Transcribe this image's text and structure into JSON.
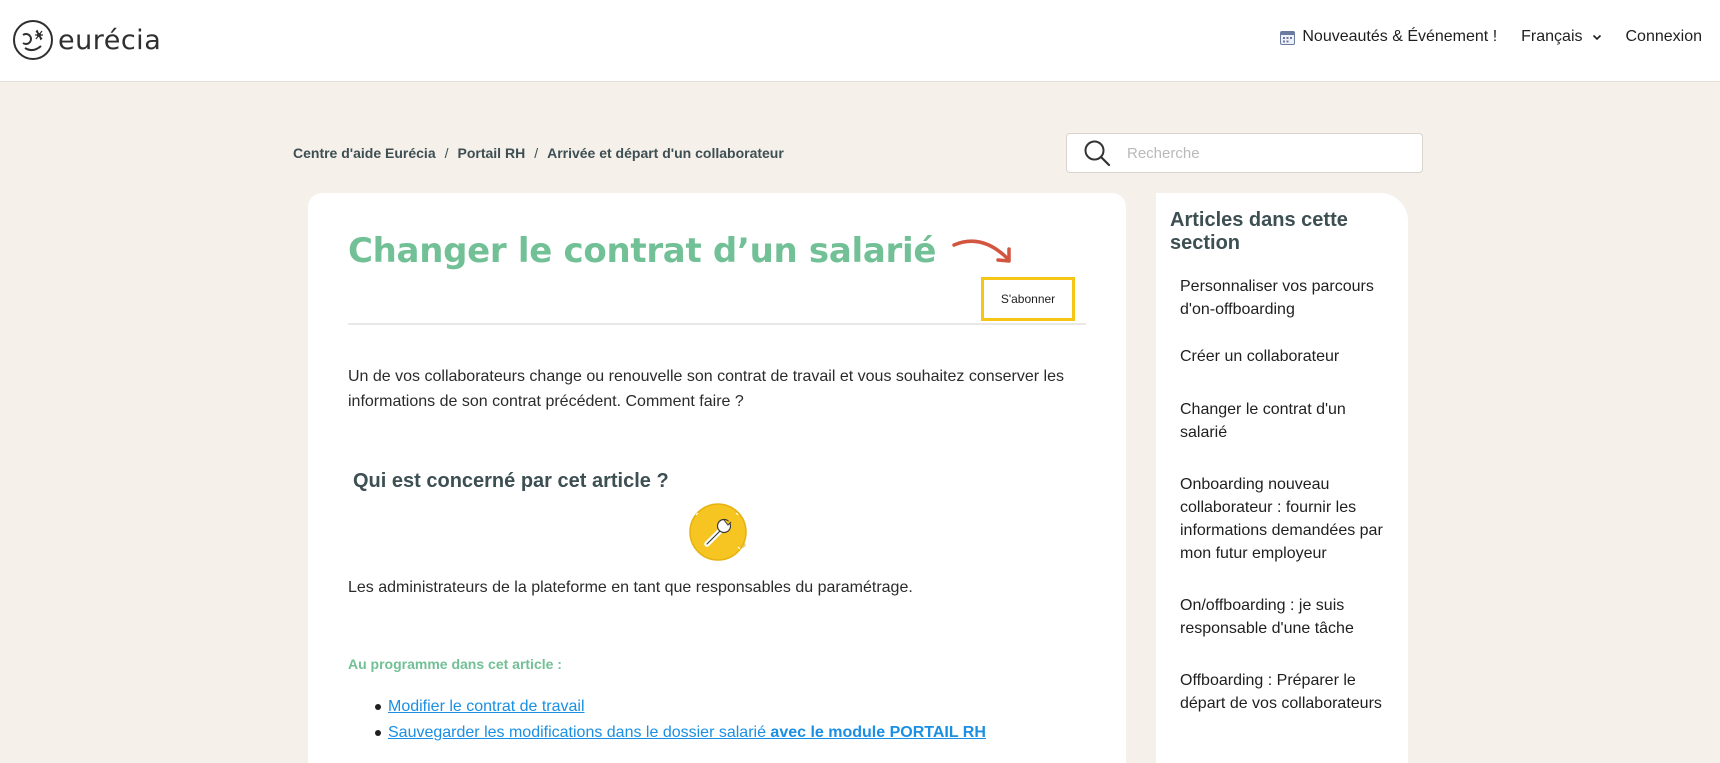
{
  "header": {
    "logo_text": "eurécia",
    "nav": {
      "news_label": "Nouveautés & Événement !",
      "language_label": "Français",
      "login_label": "Connexion"
    }
  },
  "breadcrumb": {
    "items": [
      "Centre d'aide Eurécia",
      "Portail RH",
      "Arrivée et départ d'un collaborateur"
    ],
    "separator": "/"
  },
  "search": {
    "placeholder": "Recherche"
  },
  "article": {
    "title": "Changer le contrat d’un salarié",
    "subscribe_label": "S'abonner",
    "intro": "Un de vos collaborateurs change ou renouvelle son contrat de travail et vous souhaitez conserver les informations de son contrat précédent. Comment faire ?",
    "section_heading": "Qui est concerné par cet article ?",
    "audience": "Les administrateurs de la plateforme en tant que responsables du paramétrage.",
    "programme_label": "Au programme dans cet article :",
    "toc": {
      "item1": "Modifier le contrat de travail",
      "item2_plain": "Sauvegarder les modifications dans le dossier salarié ",
      "item2_bold": "avec le module PORTAIL RH"
    }
  },
  "sidebar": {
    "title": "Articles dans cette section",
    "items": [
      "Personnaliser vos parcours d'on-offboarding",
      "Créer un collaborateur",
      "Changer le contrat d'un salarié",
      "Onboarding nouveau collaborateur : fournir les informations demandées par mon futur employeur",
      "On/offboarding : je suis responsable d'une tâche",
      "Offboarding : Préparer le départ de vos collaborateurs"
    ]
  },
  "colors": {
    "brand_green": "#72c096",
    "heading_dark": "#3d4f53",
    "link_blue": "#1a8fe3",
    "subscribe_border": "#f5c518",
    "page_background": "#f5f0ea",
    "arrow_red": "#d2553f"
  },
  "icons": [
    "eurecia-logo-icon",
    "calendar-icon",
    "chevron-down-icon",
    "search-icon",
    "curved-arrow-icon",
    "wrench-icon"
  ]
}
